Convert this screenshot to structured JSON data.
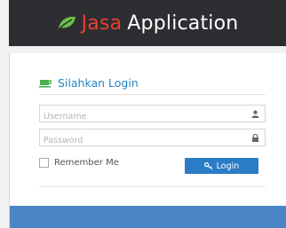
{
  "header": {
    "brand_word1": "Jasa",
    "brand_word2": "Application",
    "brand_color": "#e8402c",
    "logo_icon": "leaf-icon"
  },
  "login": {
    "title": "Silahkan Login",
    "title_icon": "coffee-cup-icon",
    "username_placeholder": "Username",
    "username_icon": "user-icon",
    "password_placeholder": "Password",
    "password_icon": "lock-icon",
    "remember_label": "Remember Me",
    "button_label": "Login",
    "button_icon": "key-icon",
    "accent_color": "#2b7cc7"
  }
}
